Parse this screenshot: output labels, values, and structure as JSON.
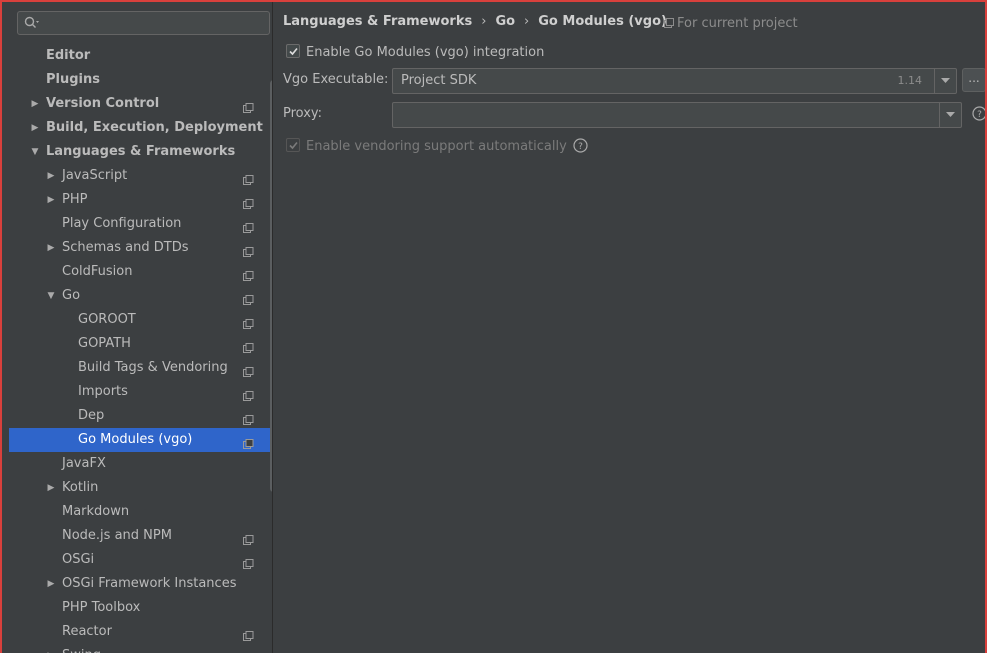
{
  "sidebar": {
    "search": {
      "value": "",
      "placeholder": ""
    },
    "items": [
      {
        "label": "Editor",
        "level": 0,
        "bold": true,
        "arrow": "",
        "proj": false,
        "selected": false
      },
      {
        "label": "Plugins",
        "level": 0,
        "bold": true,
        "arrow": "",
        "proj": false,
        "selected": false
      },
      {
        "label": "Version Control",
        "level": 0,
        "bold": true,
        "arrow": "right",
        "proj": true,
        "selected": false
      },
      {
        "label": "Build, Execution, Deployment",
        "level": 0,
        "bold": true,
        "arrow": "right",
        "proj": false,
        "selected": false
      },
      {
        "label": "Languages & Frameworks",
        "level": 0,
        "bold": true,
        "arrow": "down",
        "proj": false,
        "selected": false
      },
      {
        "label": "JavaScript",
        "level": 1,
        "bold": false,
        "arrow": "right",
        "proj": true,
        "selected": false
      },
      {
        "label": "PHP",
        "level": 1,
        "bold": false,
        "arrow": "right",
        "proj": true,
        "selected": false
      },
      {
        "label": "Play Configuration",
        "level": 1,
        "bold": false,
        "arrow": "",
        "proj": true,
        "selected": false
      },
      {
        "label": "Schemas and DTDs",
        "level": 1,
        "bold": false,
        "arrow": "right",
        "proj": true,
        "selected": false
      },
      {
        "label": "ColdFusion",
        "level": 1,
        "bold": false,
        "arrow": "",
        "proj": true,
        "selected": false
      },
      {
        "label": "Go",
        "level": 1,
        "bold": false,
        "arrow": "down",
        "proj": true,
        "selected": false
      },
      {
        "label": "GOROOT",
        "level": 2,
        "bold": false,
        "arrow": "",
        "proj": true,
        "selected": false
      },
      {
        "label": "GOPATH",
        "level": 2,
        "bold": false,
        "arrow": "",
        "proj": true,
        "selected": false
      },
      {
        "label": "Build Tags & Vendoring",
        "level": 2,
        "bold": false,
        "arrow": "",
        "proj": true,
        "selected": false
      },
      {
        "label": "Imports",
        "level": 2,
        "bold": false,
        "arrow": "",
        "proj": true,
        "selected": false
      },
      {
        "label": "Dep",
        "level": 2,
        "bold": false,
        "arrow": "",
        "proj": true,
        "selected": false
      },
      {
        "label": "Go Modules (vgo)",
        "level": 2,
        "bold": false,
        "arrow": "",
        "proj": true,
        "selected": true
      },
      {
        "label": "JavaFX",
        "level": 1,
        "bold": false,
        "arrow": "",
        "proj": false,
        "selected": false
      },
      {
        "label": "Kotlin",
        "level": 1,
        "bold": false,
        "arrow": "right",
        "proj": false,
        "selected": false
      },
      {
        "label": "Markdown",
        "level": 1,
        "bold": false,
        "arrow": "",
        "proj": false,
        "selected": false
      },
      {
        "label": "Node.js and NPM",
        "level": 1,
        "bold": false,
        "arrow": "",
        "proj": true,
        "selected": false
      },
      {
        "label": "OSGi",
        "level": 1,
        "bold": false,
        "arrow": "",
        "proj": true,
        "selected": false
      },
      {
        "label": "OSGi Framework Instances",
        "level": 1,
        "bold": false,
        "arrow": "right",
        "proj": false,
        "selected": false
      },
      {
        "label": "PHP Toolbox",
        "level": 1,
        "bold": false,
        "arrow": "",
        "proj": false,
        "selected": false
      },
      {
        "label": "Reactor",
        "level": 1,
        "bold": false,
        "arrow": "",
        "proj": true,
        "selected": false
      },
      {
        "label": "Swing",
        "level": 1,
        "bold": false,
        "arrow": "right",
        "proj": false,
        "selected": false
      }
    ]
  },
  "main": {
    "breadcrumb": [
      "Languages & Frameworks",
      "Go",
      "Go Modules (vgo)"
    ],
    "for_current_project": "For current project",
    "enable_integration": {
      "label": "Enable Go Modules (vgo) integration",
      "checked": true
    },
    "vgo_executable": {
      "label": "Vgo Executable:",
      "value": "Project SDK",
      "version": "1.14",
      "browse_label": "..."
    },
    "proxy": {
      "label": "Proxy:",
      "value": ""
    },
    "vendoring": {
      "label": "Enable vendoring support automatically",
      "checked": true,
      "disabled": true
    }
  },
  "colors": {
    "selection": "#2f65ca",
    "frame": "#d9403c",
    "background": "#3c3f41"
  }
}
